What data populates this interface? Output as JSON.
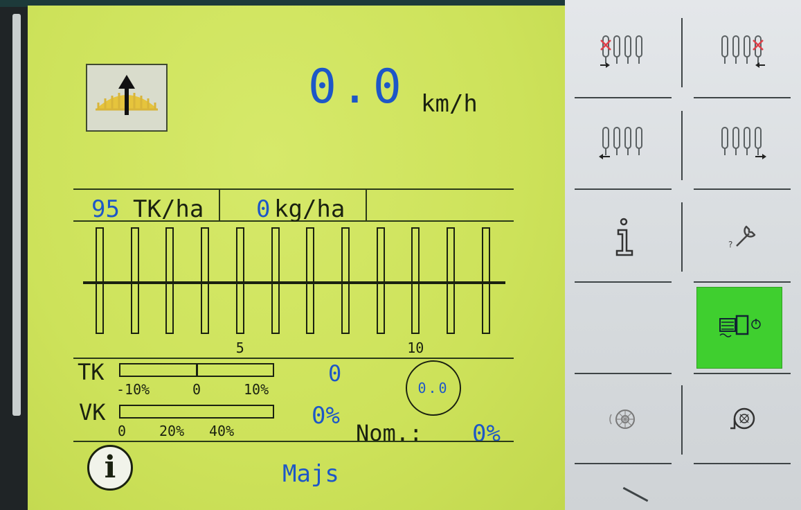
{
  "speed": {
    "value": "0.0",
    "unit": "km/h"
  },
  "rates": {
    "seed_value": "95",
    "seed_unit": "TK/ha",
    "fert_value": "0",
    "fert_unit": "kg/ha"
  },
  "rows": {
    "count": 12,
    "labels": [
      "5",
      "10"
    ],
    "label_positions": [
      5,
      10
    ]
  },
  "tk": {
    "label": "TK",
    "ticks": [
      "-10%",
      "0",
      "10%"
    ],
    "value": "0",
    "deviation_percent": 0
  },
  "vk": {
    "label": "VK",
    "ticks": [
      "0",
      "20%",
      "40%"
    ],
    "value": "0%",
    "fill_percent": 0
  },
  "circle_gauge": {
    "value": "0.0"
  },
  "nominal": {
    "label": "Nom.:",
    "value": "0%"
  },
  "crop": {
    "name": "Majs"
  },
  "info_button": {
    "glyph": "i"
  },
  "soft_keys": [
    {
      "id": "left-section-off",
      "icon": "rows-left-off-icon"
    },
    {
      "id": "right-section-off",
      "icon": "rows-right-off-icon"
    },
    {
      "id": "left-section-on",
      "icon": "rows-left-on-icon"
    },
    {
      "id": "right-section-on",
      "icon": "rows-right-on-icon"
    },
    {
      "id": "info",
      "icon": "info-icon"
    },
    {
      "id": "service",
      "icon": "wrench-icon"
    },
    {
      "id": "empty",
      "icon": ""
    },
    {
      "id": "drive-toggle",
      "icon": "drive-power-icon",
      "active": true
    },
    {
      "id": "disc",
      "icon": "disc-icon"
    },
    {
      "id": "fan",
      "icon": "fan-icon"
    }
  ],
  "colors": {
    "screen_bg": "#cde25a",
    "text_blue": "#1d57c7",
    "text_dark": "#1a2110",
    "active_key": "#3fcf2f",
    "panel_bg": "#dcdfe2"
  }
}
